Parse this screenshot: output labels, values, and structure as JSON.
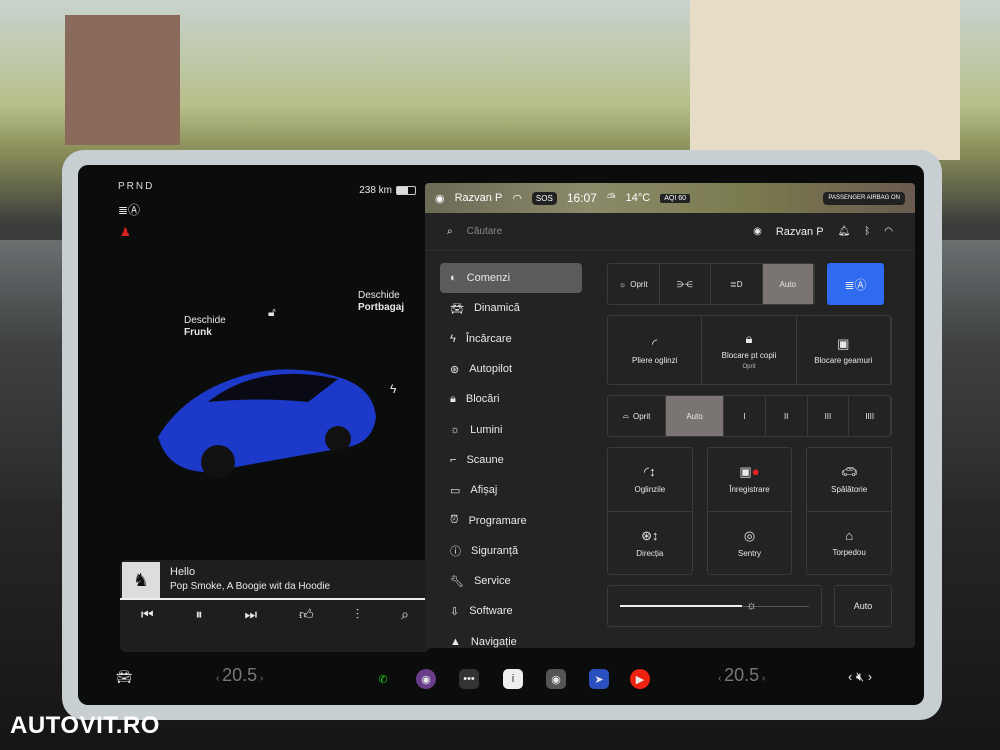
{
  "left": {
    "gear": "PRND",
    "range": "238 km",
    "battery_fraction": 0.6,
    "frunk": {
      "line1": "Deschide",
      "line2": "Frunk"
    },
    "trunk": {
      "line1": "Deschide",
      "line2": "Portbagaj"
    },
    "media": {
      "song": "Hello",
      "artist": "Pop Smoke, A Boogie wit da Hoodie",
      "progress": 1.0
    }
  },
  "status": {
    "user": "Razvan P",
    "sos": "SOS",
    "time": "16:07",
    "temp": "14°C",
    "aqi": "AQI 60",
    "airbag": "PASSENGER AIRBAG ON"
  },
  "topbar": {
    "search_placeholder": "Căutare",
    "user": "Razvan P"
  },
  "menu": [
    "Comenzi",
    "Dinamică",
    "Încărcare",
    "Autopilot",
    "Blocări",
    "Lumini",
    "Scaune",
    "Afișaj",
    "Programare",
    "Siguranță",
    "Service",
    "Software",
    "Navigație"
  ],
  "controls": {
    "lights": {
      "off": "Oprit",
      "auto": "Auto"
    },
    "mirrors_fold": "Pliere oglinzi",
    "child_lock": "Blocare pt copii",
    "child_lock_state": "Oprit",
    "window_lock": "Blocare geamuri",
    "wipers": {
      "off": "Oprit",
      "auto": "Auto",
      "speeds": [
        "I",
        "II",
        "III",
        "IIII"
      ]
    },
    "tiles": [
      "Oglinzile",
      "Înregistrare",
      "Spălătorie",
      "Direcția",
      "Sentry",
      "Torpedou"
    ],
    "brightness": 0.67,
    "brightness_auto": "Auto"
  },
  "dock": {
    "temp_left": "20.5",
    "temp_right": "20.5"
  },
  "watermark": "AUTOVIT.RO"
}
